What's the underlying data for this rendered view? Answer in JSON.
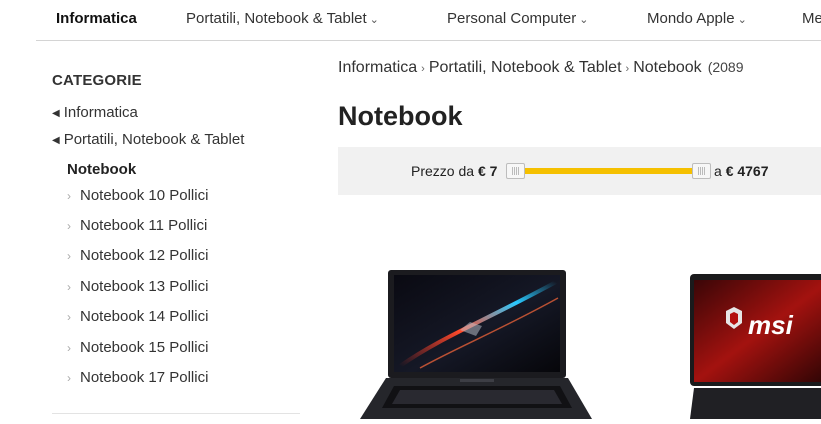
{
  "topnav": {
    "items": [
      {
        "label": "Informatica"
      },
      {
        "label": "Portatili, Notebook & Tablet"
      },
      {
        "label": "Personal Computer"
      },
      {
        "label": "Mondo Apple"
      },
      {
        "label": "Me"
      }
    ],
    "chevron": "⌄"
  },
  "sidebar": {
    "title": "CATEGORIE",
    "parents": [
      {
        "label": "Informatica",
        "icon": "caret-left-icon"
      },
      {
        "label": "Portatili, Notebook & Tablet",
        "icon": "caret-left-icon"
      }
    ],
    "current": "Notebook",
    "subcategories": [
      {
        "label": "Notebook 10 Pollici"
      },
      {
        "label": "Notebook 11 Pollici"
      },
      {
        "label": "Notebook 12 Pollici"
      },
      {
        "label": "Notebook 13 Pollici"
      },
      {
        "label": "Notebook 14 Pollici"
      },
      {
        "label": "Notebook 15 Pollici"
      },
      {
        "label": "Notebook 17 Pollici"
      }
    ]
  },
  "breadcrumb": {
    "items": [
      "Informatica",
      "Portatili, Notebook & Tablet",
      "Notebook"
    ],
    "count": "(2089"
  },
  "page": {
    "title": "Notebook"
  },
  "price_filter": {
    "from_label": "Prezzo da",
    "from_value": "€ 7",
    "to_label": "a",
    "to_value": "€ 4767",
    "track_color": "#f5c000"
  },
  "products": [
    {
      "logo_text": "",
      "icon": "asus-rog-laptop-image"
    },
    {
      "logo_text": "msi",
      "icon": "msi-laptop-image"
    }
  ]
}
